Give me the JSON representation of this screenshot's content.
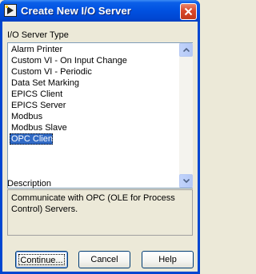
{
  "window": {
    "title": "Create New I/O Server"
  },
  "server_type": {
    "label": "I/O Server Type",
    "items": [
      "Alarm Printer",
      "Custom VI - On Input Change",
      "Custom VI - Periodic",
      "Data Set Marking",
      "EPICS Client",
      "EPICS Server",
      "Modbus",
      "Modbus Slave",
      "OPC Client"
    ],
    "selected": "OPC Client"
  },
  "description": {
    "label": "Description",
    "text": "Communicate with OPC (OLE for Process Control) Servers."
  },
  "buttons": {
    "continue_label": "Continue...",
    "cancel_label": "Cancel",
    "help_label": "Help"
  },
  "colors": {
    "titlebar": "#0050e0",
    "selection": "#316ac5",
    "dialog_bg": "#ece9d8"
  },
  "icons": {
    "app": "labview-app-icon",
    "close": "close-icon",
    "scroll_up": "arrow-up-icon",
    "scroll_down": "arrow-down-icon"
  }
}
